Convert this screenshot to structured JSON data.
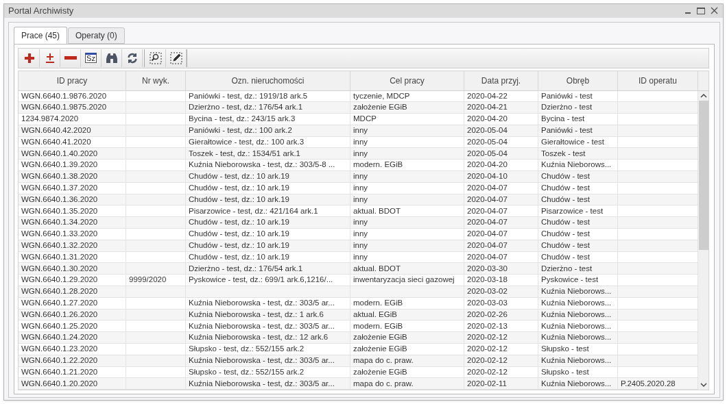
{
  "window": {
    "title": "Portal Archiwisty"
  },
  "tabs": [
    {
      "label": "Prace (45)",
      "selected": true
    },
    {
      "label": "Operaty (0)",
      "selected": false
    }
  ],
  "toolbar": [
    {
      "kind": "add"
    },
    {
      "kind": "plus-minus"
    },
    {
      "kind": "remove"
    },
    {
      "kind": "text",
      "label": "Sz"
    },
    {
      "kind": "binoculars"
    },
    {
      "kind": "refresh"
    },
    {
      "kind": "separator"
    },
    {
      "kind": "zoom-select"
    },
    {
      "kind": "edit-select"
    }
  ],
  "table": {
    "columns": [
      "ID pracy",
      "Nr wyk.",
      "Ozn. nieruchomości",
      "Cel pracy",
      "Data przyj.",
      "Obręb",
      "ID operatu"
    ],
    "rows": [
      [
        "WGN.6640.1.9876.2020",
        "",
        "Paniówki - test, dz.: 1919/18 ark.5",
        "tyczenie, MDCP",
        "2020-04-22",
        "Paniówki - test",
        ""
      ],
      [
        "WGN.6640.1.9875.2020",
        "",
        "Dzierżno - test, dz.: 176/54 ark.1",
        "założenie EGiB",
        "2020-04-21",
        "Dzierżno - test",
        ""
      ],
      [
        "1234.9874.2020",
        "",
        "Bycina - test, dz.: 243/15 ark.3",
        "MDCP",
        "2020-04-20",
        "Bycina - test",
        ""
      ],
      [
        "WGN.6640.42.2020",
        "",
        "Paniówki - test, dz.: 100 ark.2",
        "inny",
        "2020-05-04",
        "Paniówki - test",
        ""
      ],
      [
        "WGN.6640.41.2020",
        "",
        "Gierałtowice - test, dz.: 100 ark.3",
        "inny",
        "2020-05-04",
        "Gierałtowice - test",
        ""
      ],
      [
        "WGN.6640.1.40.2020",
        "",
        "Toszek - test, dz.: 1534/51 ark.1",
        "inny",
        "2020-05-04",
        "Toszek - test",
        ""
      ],
      [
        "WGN.6640.1.39.2020",
        "",
        "Kuźnia Nieborowska - test, dz.: 303/5-8 ...",
        "modern. EGiB",
        "2020-04-20",
        "Kuźnia Nieborows...",
        ""
      ],
      [
        "WGN.6640.1.38.2020",
        "",
        "Chudów - test, dz.: 10 ark.19",
        "inny",
        "2020-04-10",
        "Chudów - test",
        ""
      ],
      [
        "WGN.6640.1.37.2020",
        "",
        "Chudów - test, dz.: 10 ark.19",
        "inny",
        "2020-04-07",
        "Chudów - test",
        ""
      ],
      [
        "WGN.6640.1.36.2020",
        "",
        "Chudów - test, dz.: 10 ark.19",
        "inny",
        "2020-04-07",
        "Chudów - test",
        ""
      ],
      [
        "WGN.6640.1.35.2020",
        "",
        "Pisarzowice - test, dz.: 421/164 ark.1",
        "aktual. BDOT",
        "2020-04-07",
        "Pisarzowice - test",
        ""
      ],
      [
        "WGN.6640.1.34.2020",
        "",
        "Chudów - test, dz.: 10 ark.19",
        "inny",
        "2020-04-07",
        "Chudów - test",
        ""
      ],
      [
        "WGN.6640.1.33.2020",
        "",
        "Chudów - test, dz.: 10 ark.19",
        "inny",
        "2020-04-07",
        "Chudów - test",
        ""
      ],
      [
        "WGN.6640.1.32.2020",
        "",
        "Chudów - test, dz.: 10 ark.19",
        "inny",
        "2020-04-07",
        "Chudów - test",
        ""
      ],
      [
        "WGN.6640.1.31.2020",
        "",
        "Chudów - test, dz.: 10 ark.19",
        "inny",
        "2020-04-07",
        "Chudów - test",
        ""
      ],
      [
        "WGN.6640.1.30.2020",
        "",
        "Dzierżno - test, dz.: 176/54 ark.1",
        "aktual. BDOT",
        "2020-03-30",
        "Dzierżno - test",
        ""
      ],
      [
        "WGN.6640.1.29.2020",
        "9999/2020",
        "Pyskowice - test, dz.: 699/1 ark.6,1216/...",
        "inwentaryzacja sieci gazowej",
        "2020-03-18",
        "Pyskowice - test",
        ""
      ],
      [
        "WGN.6640.1.28.2020",
        "",
        "",
        "",
        "2020-03-02",
        "Kuźnia Nieborows...",
        ""
      ],
      [
        "WGN.6640.1.27.2020",
        "",
        "Kuźnia Nieborowska - test, dz.: 303/5 ar...",
        "modern. EGiB",
        "2020-03-03",
        "Kuźnia Nieborows...",
        ""
      ],
      [
        "WGN.6640.1.26.2020",
        "",
        "Kuźnia Nieborowska - test, dz.: 1 ark.6",
        "aktual. EGiB",
        "2020-02-26",
        "Kuźnia Nieborows...",
        ""
      ],
      [
        "WGN.6640.1.25.2020",
        "",
        "Kuźnia Nieborowska - test, dz.: 303/5 ar...",
        "modern. EGiB",
        "2020-02-13",
        "Kuźnia Nieborows...",
        ""
      ],
      [
        "WGN.6640.1.24.2020",
        "",
        "Kuźnia Nieborowska - test, dz.: 12 ark.6",
        "założenie EGiB",
        "2020-02-12",
        "Kuźnia Nieborows...",
        ""
      ],
      [
        "WGN.6640.1.23.2020",
        "",
        "Słupsko - test, dz.: 552/155 ark.2",
        "założenie EGiB",
        "2020-02-12",
        "Słupsko - test",
        ""
      ],
      [
        "WGN.6640.1.22.2020",
        "",
        "Kuźnia Nieborowska - test, dz.: 303/5 ar...",
        "mapa do c. praw.",
        "2020-02-12",
        "Kuźnia Nieborows...",
        ""
      ],
      [
        "WGN.6640.1.21.2020",
        "",
        "Słupsko - test, dz.: 552/155 ark.2",
        "założenie EGiB",
        "2020-02-12",
        "Słupsko - test",
        ""
      ],
      [
        "WGN.6640.1.20.2020",
        "",
        "Kuźnia Nieborowska - test, dz.: 303/5 ar...",
        "mapa do c. praw.",
        "2020-02-11",
        "Kuźnia Nieborows...",
        "P.2405.2020.28"
      ]
    ]
  }
}
